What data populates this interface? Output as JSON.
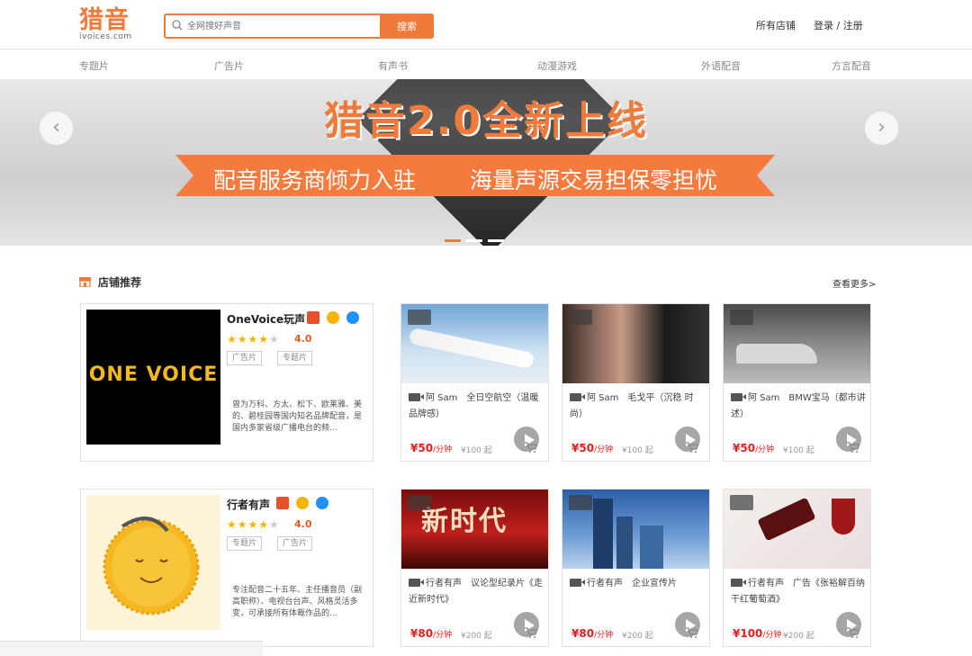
{
  "header": {
    "logo_cn": "猎音",
    "logo_en": "ivoices.com",
    "search_placeholder": "全网搜好声音",
    "search_button": "搜索",
    "all_shops": "所有店铺",
    "login": "登录 / 注册"
  },
  "nav": [
    "专题片",
    "广告片",
    "有声书",
    "动漫游戏",
    "外语配音",
    "方言配音"
  ],
  "banner": {
    "headline": "猎音2.0全新上线",
    "ribbon_left": "配音服务商倾力入驻",
    "ribbon_right": "海量声源交易担保零担忧",
    "prev": "‹",
    "next": "›",
    "active_slide": 1,
    "slide_count": 3
  },
  "section": {
    "title": "店铺推荐",
    "more": "查看更多>"
  },
  "shops": [
    {
      "name": "OneVoice玩声",
      "pic_text": "ONE VOICE",
      "rating": "4.0",
      "tags": [
        "广告片",
        "专题片"
      ],
      "desc": "曾为万科、方太、松下、欧莱雅、美的、碧桂园等国内知名品牌配音，是国内多家省级广播电台的频..."
    },
    {
      "name": "行者有声",
      "rating": "4.0",
      "tags": [
        "专题片",
        "广告片"
      ],
      "desc": "专注配音二十五年、主任播音员（副高职称）、电视台台声、风格灵活多变，可承接所有体裁作品的..."
    }
  ],
  "cards": [
    {
      "title": "阿 Sam　全日空航空（温暖品牌感）",
      "price": "¥50",
      "unit": "/分钟",
      "min": "¥100 起",
      "thumb": "plane"
    },
    {
      "title": "阿 Sam　毛戈平（沉稳 时尚）",
      "price": "¥50",
      "unit": "/分钟",
      "min": "¥100 起",
      "thumb": "beauty"
    },
    {
      "title": "阿 Sam　BMW宝马（都市讲述）",
      "price": "¥50",
      "unit": "/分钟",
      "min": "¥100 起",
      "thumb": "car"
    },
    {
      "title": "行者有声　议论型纪录片《走近新时代》",
      "price": "¥80",
      "unit": "/分钟",
      "min": "¥200 起",
      "thumb": "newera",
      "thumb_text": "新时代"
    },
    {
      "title": "行者有声　企业宣传片",
      "price": "¥80",
      "unit": "/分钟",
      "min": "¥200 起",
      "thumb": "city"
    },
    {
      "title": "行者有声　广告《张裕解百纳干红葡萄酒》",
      "price": "¥100",
      "unit": "/分钟",
      "min": "¥200 起",
      "thumb": "wine"
    }
  ],
  "colors": {
    "accent": "#f07a3a",
    "price": "#e02020",
    "star": "#f5b400"
  }
}
